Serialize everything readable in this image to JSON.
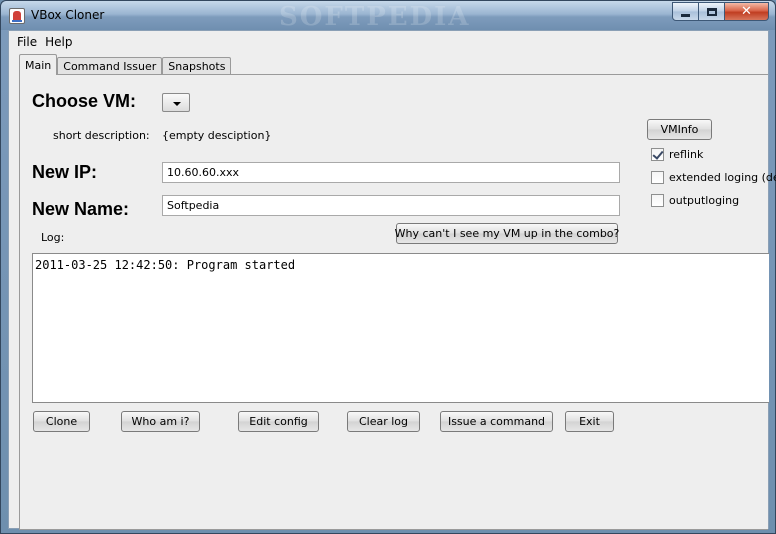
{
  "window": {
    "title": "VBox Cloner",
    "watermark": "SOFTPEDIA",
    "controls": {
      "minimize_icon": "minimize-icon",
      "maximize_icon": "maximize-icon",
      "close_icon": "close-icon",
      "close_glyph": "✕"
    }
  },
  "menu": {
    "items": [
      "File",
      "Help"
    ]
  },
  "tabs": [
    {
      "label": "Main",
      "active": true
    },
    {
      "label": "Command Issuer",
      "active": false
    },
    {
      "label": "Snapshots",
      "active": false
    }
  ],
  "main": {
    "choose_vm_label": "Choose VM:",
    "short_desc_label": "short description:",
    "short_desc_value": "{empty desciption}",
    "new_ip_label": "New IP:",
    "new_ip_value": "10.60.60.xxx",
    "new_name_label": "New Name:",
    "new_name_value": "Softpedia",
    "log_label": "Log:",
    "why_button": "Why can't I see my VM up in the combo?",
    "vminfo_button": "VMInfo",
    "options": [
      {
        "label": "reflink",
        "checked": true
      },
      {
        "label": "extended loging (debu",
        "checked": false
      },
      {
        "label": "outputloging",
        "checked": false
      }
    ],
    "log_text": "2011-03-25 12:42:50: Program started",
    "buttons": [
      "Clone",
      "Who am i?",
      "Edit config",
      "Clear log",
      "Issue a command",
      "Exit"
    ]
  }
}
